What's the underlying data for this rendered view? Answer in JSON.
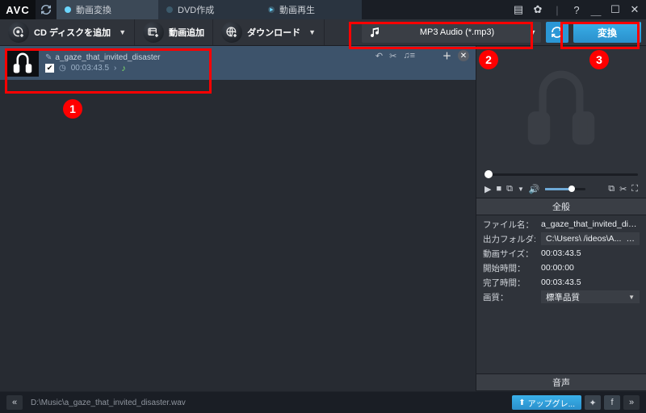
{
  "app": {
    "logo": "AVC"
  },
  "tabs": {
    "video": "動画変換",
    "dvd": "DVD作成",
    "play": "動画再生"
  },
  "toolbar": {
    "add_cd": "CD ディスクを追加",
    "add_video": "動画追加",
    "download": "ダウンロード"
  },
  "format": {
    "selected": "MP3 Audio (*.mp3)"
  },
  "convert": {
    "label": "変換"
  },
  "file": {
    "name": "a_gaze_that_invited_disaster",
    "duration": "00:03:43.5"
  },
  "info": {
    "header_general": "全般",
    "filename_k": "ファイル名：",
    "filename_v": "a_gaze_that_invited_disaster",
    "outfolder_k": "出力フォルダ:",
    "outfolder_v": "C:\\Users\\     /ideos\\A... ",
    "size_k": "動画サイズ：",
    "size_v": "00:03:43.5",
    "start_k": "開始時間：",
    "start_v": "00:00:00",
    "end_k": "完了時間：",
    "end_v": "00:03:43.5",
    "quality_k": "画質：",
    "quality_v": "標準品質",
    "header_audio": "音声"
  },
  "window_icons": {
    "settings1": "▤",
    "settings2": "✿",
    "help": "?",
    "min": "＿",
    "max": "☐",
    "close": "✕"
  },
  "status": {
    "path": "D:\\Music\\a_gaze_that_invited_disaster.wav",
    "upgrade": "アップグレ..."
  }
}
